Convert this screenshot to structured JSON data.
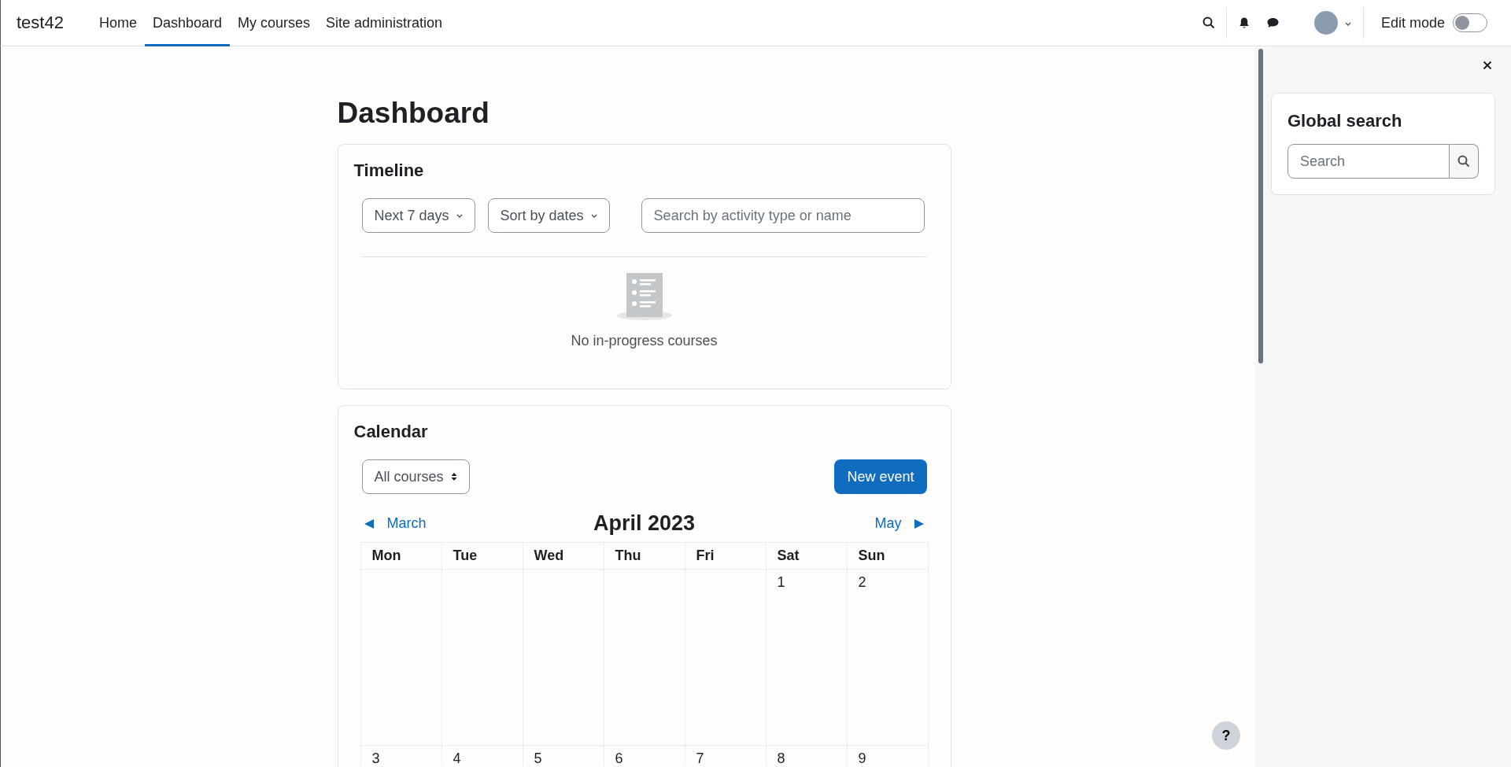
{
  "navbar": {
    "brand": "test42",
    "items": [
      {
        "label": "Home",
        "selected": false
      },
      {
        "label": "Dashboard",
        "selected": true
      },
      {
        "label": "My courses",
        "selected": false
      },
      {
        "label": "Site administration",
        "selected": false
      }
    ],
    "edit_mode": {
      "label": "Edit mode",
      "on": false
    }
  },
  "page_title": "Dashboard",
  "timeline": {
    "title": "Timeline",
    "filters": [
      "Next 7 days",
      "Sort by dates"
    ],
    "search": {
      "placeholder": "Search by activity type or name"
    },
    "empty_message": "No in-progress courses"
  },
  "calendar": {
    "title": "Calendar",
    "course_select": "All courses",
    "new_event": "New event",
    "prev": "March",
    "month": "April 2023",
    "next": "May",
    "weekdays": [
      "Mon",
      "Tue",
      "Wed",
      "Thu",
      "Fri",
      "Sat",
      "Sun"
    ],
    "weeks": [
      [
        {
          "kind": "blank"
        },
        {
          "kind": "blank"
        },
        {
          "kind": "blank"
        },
        {
          "kind": "blank"
        },
        {
          "kind": "blank"
        },
        {
          "kind": "day",
          "day": "1"
        },
        {
          "kind": "day",
          "day": "2"
        }
      ],
      [
        {
          "kind": "day",
          "day": "3"
        },
        {
          "kind": "day",
          "day": "4"
        },
        {
          "kind": "day",
          "day": "5"
        },
        {
          "kind": "day",
          "day": "6"
        },
        {
          "kind": "day",
          "day": "7"
        },
        {
          "kind": "day",
          "day": "8"
        },
        {
          "kind": "day",
          "day": "9"
        }
      ]
    ]
  },
  "drawer": {
    "block_title": "Global search",
    "search": {
      "placeholder": "Search"
    }
  },
  "help_button": "?"
}
